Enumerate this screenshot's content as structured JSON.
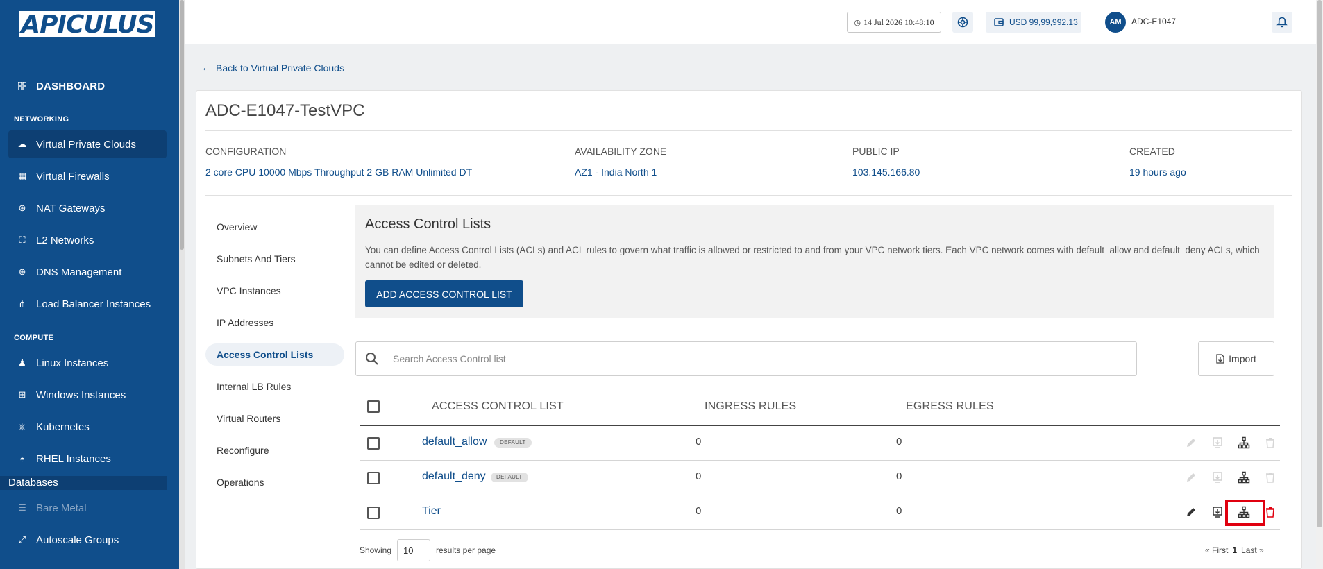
{
  "brand": {
    "logo_text": "APICULUS",
    "primary": "#104e8b",
    "danger": "#e0000f"
  },
  "sidebar": {
    "dashboard": "DASHBOARD",
    "sections": {
      "networking": "NETWORKING",
      "compute": "COMPUTE"
    },
    "networking_items": [
      {
        "label": "Virtual Private Clouds",
        "icon": "cloud-icon",
        "active": true
      },
      {
        "label": "Virtual Firewalls",
        "icon": "firewall-icon"
      },
      {
        "label": "NAT Gateways",
        "icon": "nat-icon"
      },
      {
        "label": "L2 Networks",
        "icon": "network-icon"
      },
      {
        "label": "DNS Management",
        "icon": "globe-icon"
      },
      {
        "label": "Load Balancer Instances",
        "icon": "load-balancer-icon"
      }
    ],
    "compute_items": [
      {
        "label": "Linux Instances",
        "icon": "linux-icon"
      },
      {
        "label": "Windows Instances",
        "icon": "windows-icon"
      },
      {
        "label": "Kubernetes",
        "icon": "kubernetes-icon"
      },
      {
        "label": "RHEL Instances",
        "icon": "rhel-icon"
      }
    ],
    "databases": "Databases",
    "bare_metal": "Bare Metal",
    "autoscale": "Autoscale Groups"
  },
  "header": {
    "datetime": "14 Jul 2026 10:48:10",
    "balance": "USD 99,99,992.13",
    "avatar_initials": "AM",
    "user": "ADC-E1047"
  },
  "back_link": "Back to Virtual Private Clouds",
  "vpc": {
    "name": "ADC-E1047-TestVPC",
    "meta": [
      {
        "label": "CONFIGURATION",
        "value": "2 core CPU 10000 Mbps Throughput 2 GB RAM Unlimited DT"
      },
      {
        "label": "AVAILABILITY ZONE",
        "value": "AZ1 - India North 1"
      },
      {
        "label": "PUBLIC IP",
        "value": "103.145.166.80"
      },
      {
        "label": "CREATED",
        "value": "19 hours ago"
      }
    ]
  },
  "tabs": [
    "Overview",
    "Subnets And Tiers",
    "VPC Instances",
    "IP Addresses",
    "Access Control Lists",
    "Internal LB Rules",
    "Virtual Routers",
    "Reconfigure",
    "Operations"
  ],
  "acl": {
    "title": "Access Control Lists",
    "description": "You can define Access Control Lists (ACLs) and ACL rules to govern what traffic is allowed or restricted to and from your VPC network tiers. Each VPC network comes with default_allow and default_deny ACLs, which cannot be edited or deleted.",
    "add_button": "ADD ACCESS CONTROL LIST",
    "search_placeholder": "Search Access Control list",
    "import_button": "Import",
    "columns": [
      "ACCESS CONTROL LIST",
      "INGRESS RULES",
      "EGRESS RULES"
    ],
    "rows": [
      {
        "name": "default_allow",
        "badge": "DEFAULT",
        "ingress": "0",
        "egress": "0"
      },
      {
        "name": "default_deny",
        "badge": "DEFAULT",
        "ingress": "0",
        "egress": "0"
      },
      {
        "name": "Tier",
        "badge": "",
        "ingress": "0",
        "egress": "0"
      }
    ]
  },
  "pagination": {
    "showing": "Showing",
    "per_page": "10",
    "per_page_label": "results per page",
    "first": "« First",
    "current": "1",
    "last": "Last »"
  }
}
